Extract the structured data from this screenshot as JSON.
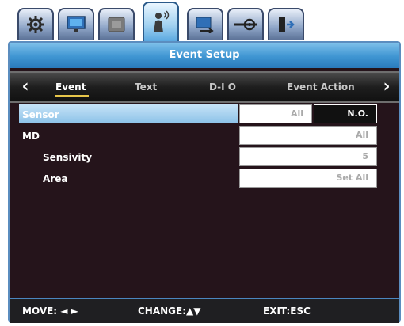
{
  "tabs": [
    {
      "icon": "gear-icon"
    },
    {
      "icon": "monitor-icon"
    },
    {
      "icon": "hdd-icon",
      "label": "HDD"
    },
    {
      "icon": "person-motion-icon",
      "active": true
    },
    {
      "icon": "network-icon"
    },
    {
      "icon": "settings-slider-icon"
    },
    {
      "icon": "exit-door-icon"
    }
  ],
  "window": {
    "title": "Event Setup"
  },
  "subnav": {
    "prev_icon": "‹",
    "next_icon": "›",
    "items": [
      "Event",
      "Text",
      "D-I O",
      "Event Action"
    ],
    "active_index": 0
  },
  "rows": [
    {
      "label": "Sensor",
      "value": "All",
      "value2": "N.O."
    },
    {
      "label": "MD",
      "value": "All"
    },
    {
      "label": "Sensivity",
      "value": "5"
    },
    {
      "label": "Area",
      "value": "Set All"
    }
  ],
  "footer": {
    "move": "MOVE: ◄ ►",
    "change": "CHANGE:▲▼",
    "exit": "EXIT:ESC"
  },
  "colors": {
    "accent": "#3f95d2",
    "panel_bg": "#25141b",
    "highlight": "#8cc2e8",
    "underline": "#e6c54a"
  }
}
